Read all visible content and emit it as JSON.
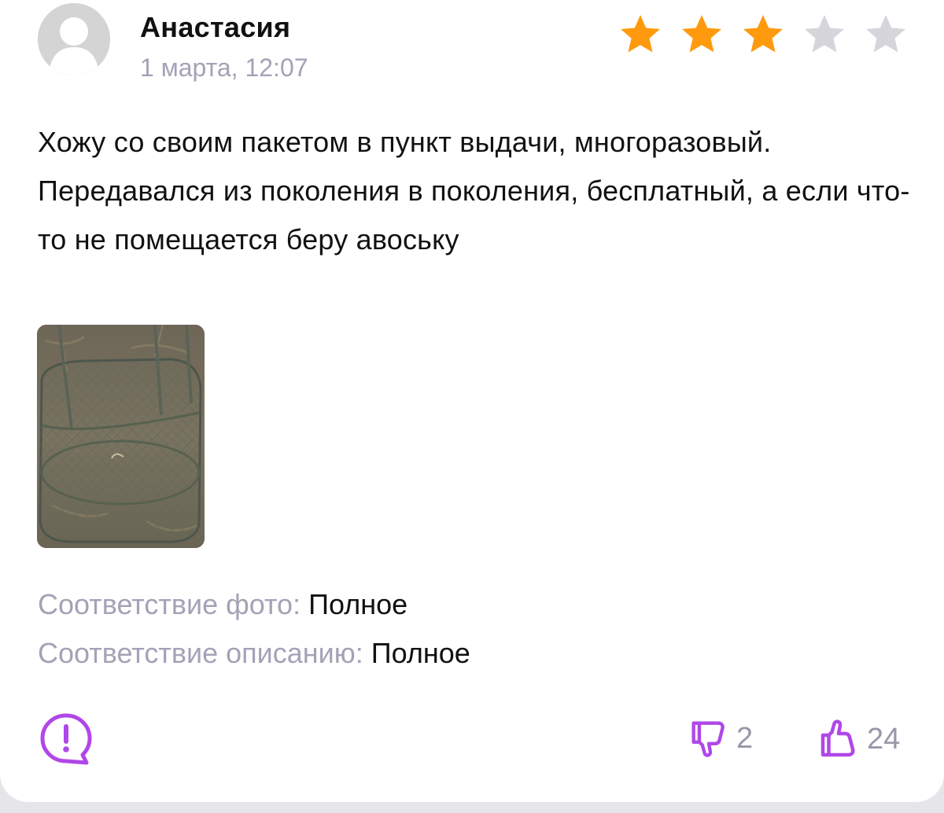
{
  "review": {
    "author": "Анастасия",
    "date": "1 марта, 12:07",
    "rating": 3,
    "rating_max": 5,
    "text": "Хожу со своим пакетом в пункт выдачи, многоразовый. Передавался из поколения в поколения, бесплатный, а если что-то не помещается беру авоську",
    "attributes": [
      {
        "label": "Соответствие фото:",
        "value": "Полное"
      },
      {
        "label": "Соответствие описанию:",
        "value": "Полное"
      }
    ],
    "votes": {
      "dislikes": "2",
      "likes": "24"
    }
  },
  "colors": {
    "star_filled": "#ff9a0e",
    "star_empty": "#d5d5db",
    "accent": "#b047e8",
    "muted_text": "#a5a2b6"
  },
  "icons": {
    "avatar": "user-placeholder-icon",
    "report": "report-bubble-icon",
    "dislike": "thumb-down-icon",
    "like": "thumb-up-icon"
  }
}
